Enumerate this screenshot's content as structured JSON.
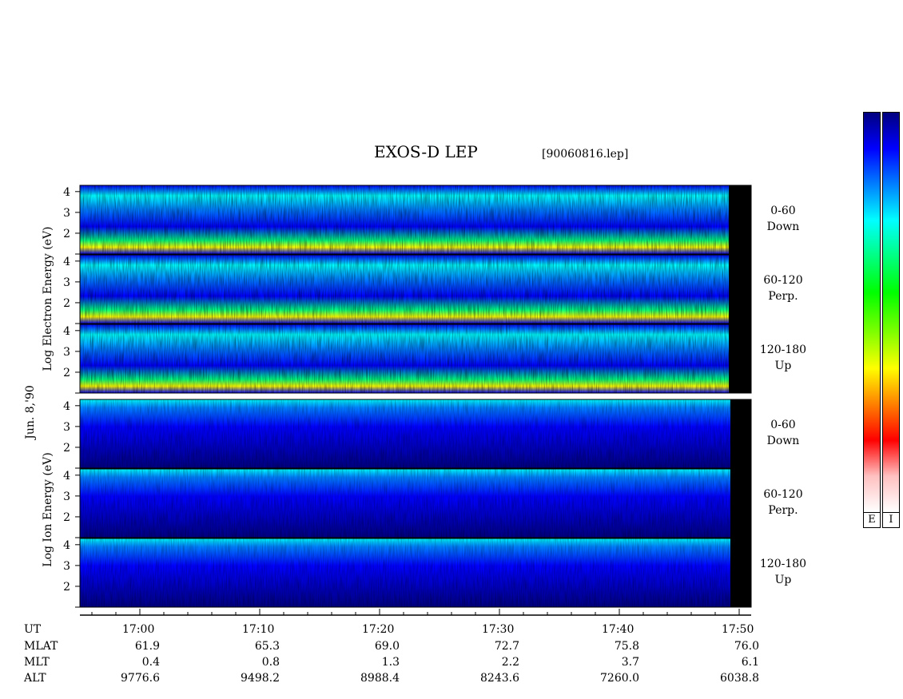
{
  "header": {
    "title": "EXOS-D LEP",
    "subtitle": "[90060816.lep]"
  },
  "side_labels": {
    "date": "Jun. 8,'90",
    "electron_label": "Log   Electron   Energy (eV)",
    "ion_label": "Log    Ion   Energy (eV)"
  },
  "chart_data": {
    "type": "heatmap",
    "title": "EXOS-D LEP",
    "xlabel": "UT",
    "x_tick_labels": [
      "17:00",
      "17:10",
      "17:20",
      "17:30",
      "17:40",
      "17:50"
    ],
    "xlim": [
      "16:55",
      "17:51"
    ],
    "ylim": [
      1,
      4.3
    ],
    "y_tick_labels": [
      "2",
      "3",
      "4"
    ],
    "panels": [
      {
        "species": "Electron",
        "angle": "0-60",
        "direction": "Down"
      },
      {
        "species": "Electron",
        "angle": "60-120",
        "direction": "Perp."
      },
      {
        "species": "Electron",
        "angle": "120-180",
        "direction": "Up"
      },
      {
        "species": "Ion",
        "angle": "0-60",
        "direction": "Down"
      },
      {
        "species": "Ion",
        "angle": "60-120",
        "direction": "Perp."
      },
      {
        "species": "Ion",
        "angle": "120-180",
        "direction": "Up"
      }
    ],
    "colorscale": [
      "#000080",
      "#0000ff",
      "#0080ff",
      "#00ffff",
      "#00ff80",
      "#00ff00",
      "#80ff00",
      "#ffff00",
      "#ff8000",
      "#ff0000",
      "#ffc0c0",
      "#ffffff"
    ],
    "colorbar_labels": [
      "E",
      "I"
    ]
  },
  "ephemeris": {
    "rows": [
      {
        "label": "UT",
        "values": [
          "17:00",
          "17:10",
          "17:20",
          "17:30",
          "17:40",
          "17:50"
        ]
      },
      {
        "label": "MLAT",
        "values": [
          "61.9",
          "65.3",
          "69.0",
          "72.7",
          "75.8",
          "76.0"
        ]
      },
      {
        "label": "MLT",
        "values": [
          "0.4",
          "0.8",
          "1.3",
          "2.2",
          "3.7",
          "6.1"
        ]
      },
      {
        "label": "ALT",
        "values": [
          "9776.6",
          "9498.2",
          "8988.4",
          "8243.6",
          "7260.0",
          "6038.8"
        ]
      }
    ]
  }
}
